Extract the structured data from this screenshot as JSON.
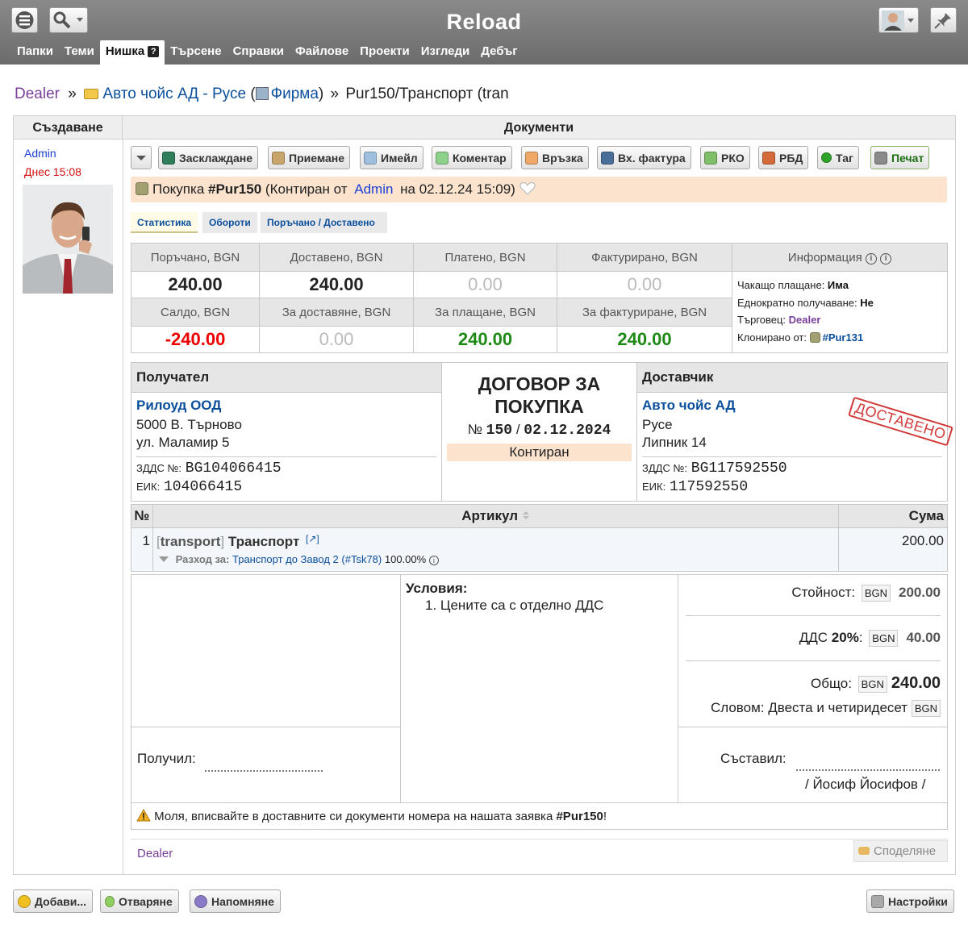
{
  "app": {
    "title": "Reload"
  },
  "nav": [
    "Папки",
    "Теми",
    "Нишка",
    "Търсене",
    "Справки",
    "Файлове",
    "Проекти",
    "Изгледи",
    "Дебъг"
  ],
  "nav_active": "Нишка",
  "nav_help": "?",
  "breadcrumb": {
    "root": "Dealer",
    "sep1": "»",
    "folder": "Авто чойс АД - Русе",
    "paren_open": "(",
    "folder_type": "Фирма",
    "paren_close": ")",
    "sep2": "»",
    "current": "Pur150/Транспорт (tran"
  },
  "sidebar": {
    "header": "Създаване",
    "author": "Admin",
    "time": "Днес 15:08"
  },
  "main": {
    "header": "Документи"
  },
  "toolbar": [
    "Засклаждане",
    "Приемане",
    "Имейл",
    "Коментар",
    "Връзка",
    "Вх. фактура",
    "РКО",
    "РБД",
    "Таг",
    "Печат"
  ],
  "doc_title": {
    "prefix": "Покупка",
    "number": "#Pur150",
    "state_open": "(Контиран от",
    "user": "Admin",
    "state_close": "на 02.12.24 15:09)"
  },
  "tabs": [
    "Статистика",
    "Обороти",
    "Поръчано / Доставено"
  ],
  "stats": {
    "headers_top": [
      "Поръчано, BGN",
      "Доставено, BGN",
      "Платено, BGN",
      "Фактурирано, BGN"
    ],
    "values_top": [
      "240.00",
      "240.00",
      "0.00",
      "0.00"
    ],
    "headers_bottom": [
      "Салдо, BGN",
      "За доставяне, BGN",
      "За плащане, BGN",
      "За фактуриране, BGN"
    ],
    "values_bottom": [
      "-240.00",
      "0.00",
      "240.00",
      "240.00"
    ],
    "info_header": "Информация",
    "info": [
      {
        "label": "Чакащо плащане",
        "value": "Има"
      },
      {
        "label": "Еднократно получаване",
        "value": "Не"
      },
      {
        "label": "Търговец",
        "value": "Dealer"
      },
      {
        "label": "Клонирано от",
        "value": "#Pur131"
      }
    ]
  },
  "recipient": {
    "heading": "Получател",
    "name": "Рилоуд ООД",
    "address1": "5000 В. Търново",
    "address2": "ул. Маламир 5",
    "vat_label": "ЗДДС №:",
    "vat": "BG104066415",
    "eik_label": "ЕИК:",
    "eik": "104066415"
  },
  "contract": {
    "title1": "ДОГОВОР ЗА",
    "title2": "ПОКУПКА",
    "no_label": "№",
    "number": "150",
    "slash": "/",
    "date": "02.12.2024",
    "status": "Контиран"
  },
  "supplier": {
    "heading": "Доставчик",
    "name": "Авто чойс АД",
    "address1": "Русе",
    "address2": "Липник 14",
    "vat_label": "ЗДДС №:",
    "vat": "BG117592550",
    "eik_label": "ЕИК:",
    "eik": "117592550",
    "stamp": "ДОСТАВЕНО"
  },
  "items": {
    "col_no": "№",
    "col_article": "Артикул",
    "col_sum": "Сума",
    "rows": [
      {
        "no": "1",
        "code": "transport",
        "name": "Транспорт",
        "link": "[↗]",
        "expense_label": "Разход за:",
        "expense_link": "Транспорт до Завод 2 (#Tsk78)",
        "expense_pct": "100.00%",
        "sum": "200.00"
      }
    ]
  },
  "conditions": {
    "title": "Условия:",
    "items": [
      "Цените са с отделно ДДС"
    ]
  },
  "totals": {
    "value_label": "Стойност:",
    "currency": "BGN",
    "value": "200.00",
    "vat_label": "ДДС",
    "vat_rate": "20%",
    "vat_colon": ":",
    "vat": "40.00",
    "total_label": "Общо:",
    "total": "240.00",
    "words_label": "Словом:",
    "words": "Двеста и четиридесет"
  },
  "signatures": {
    "received": "Получил:",
    "composed": "Съставил:",
    "composer": "/ Йосиф Йосифов /"
  },
  "note": {
    "text": "Моля, вписвайте в доставните си документи номера на нашата заявка",
    "ref": "#Pur150",
    "end": "!"
  },
  "footer_main": {
    "user": "Dealer",
    "share": "Споделяне"
  },
  "footer_buttons": {
    "add": "Добави...",
    "open": "Отваряне",
    "remind": "Напомняне",
    "settings": "Настройки"
  }
}
